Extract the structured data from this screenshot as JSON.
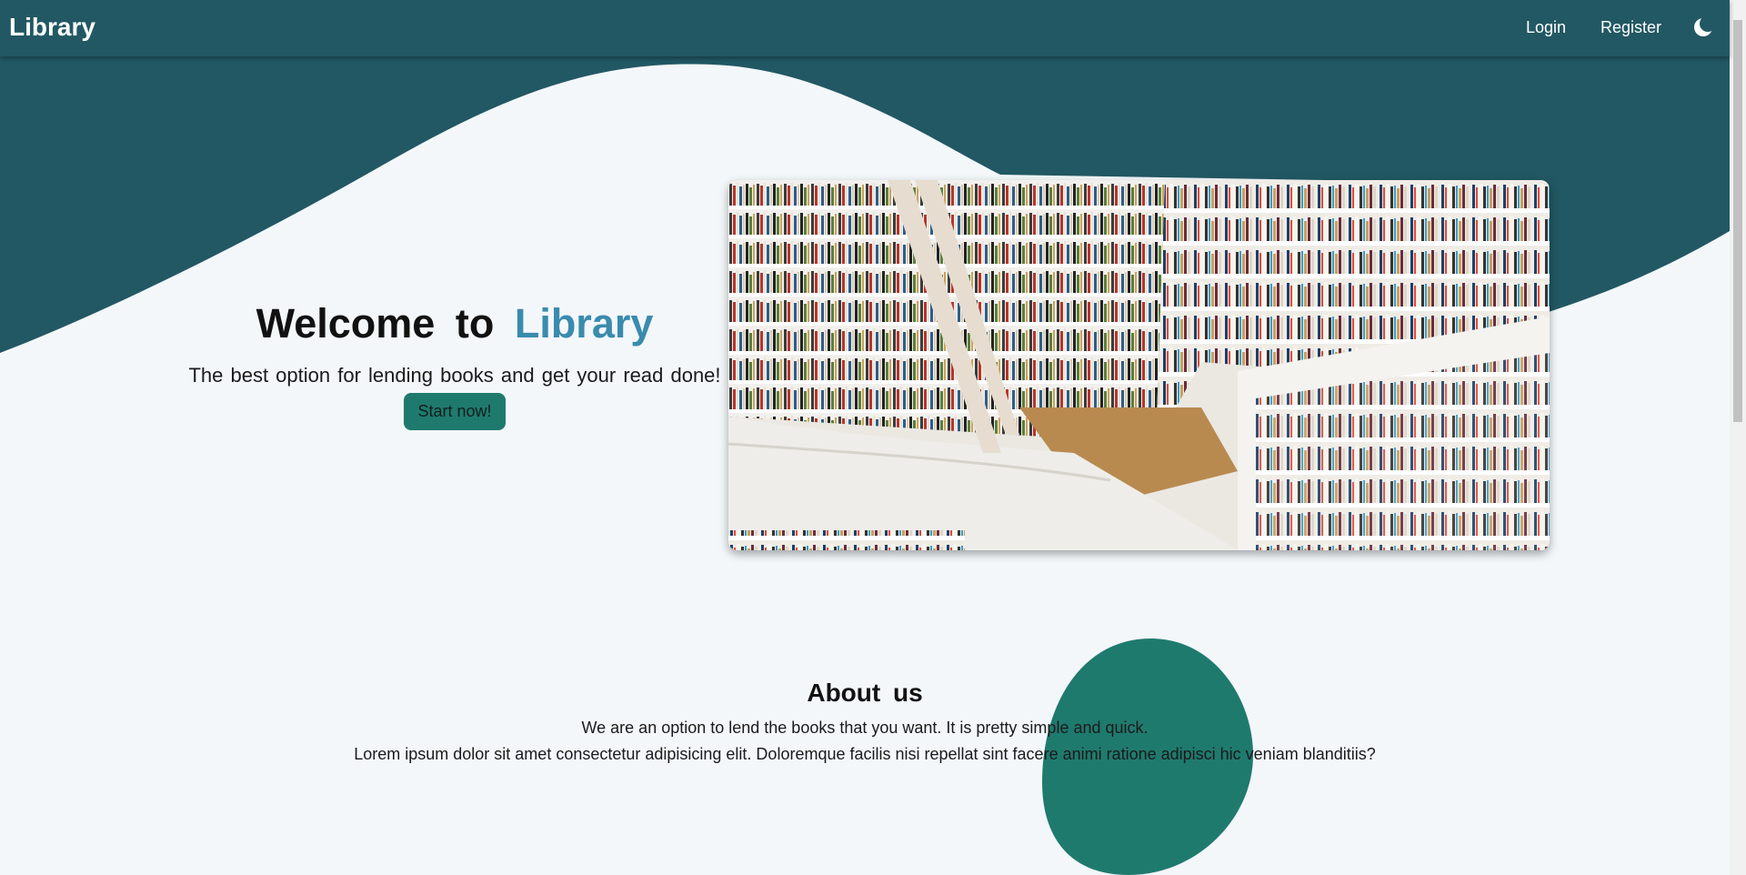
{
  "navbar": {
    "brand": "Library",
    "links": [
      {
        "label": "Login"
      },
      {
        "label": "Register"
      }
    ],
    "theme_icon": "moon-icon"
  },
  "hero": {
    "title_prefix": "Welcome to",
    "title_accent": "Library",
    "subtitle": "The best option for lending books and get your read done!",
    "cta_label": "Start now!",
    "image_icon": "library-bookshelves-image"
  },
  "about": {
    "title": "About us",
    "line1": "We are an option to lend the books that you want. It is pretty simple and quick.",
    "line2": "Lorem ipsum dolor sit amet consectetur adipisicing elit. Doloremque facilis nisi repellat sint facere animi ratione adipisci hic veniam blanditiis?"
  },
  "colors": {
    "primary": "#225863",
    "accent": "#3a8bad",
    "button": "#1f7a6e",
    "background": "#f3f7fa"
  }
}
